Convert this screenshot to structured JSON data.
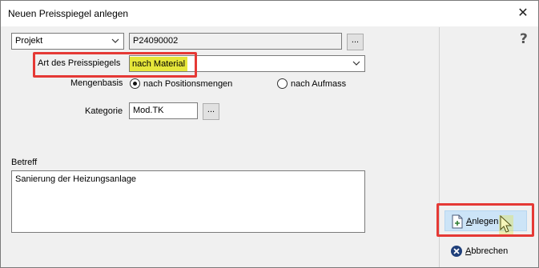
{
  "window": {
    "title": "Neuen Preisspiegel anlegen",
    "close_glyph": "✕"
  },
  "form": {
    "source_type": {
      "value": "Projekt"
    },
    "project_number": {
      "value": "P24090002"
    },
    "browse_project_label": "...",
    "art_label": "Art des Preisspiegels",
    "art_value": "nach Material",
    "mengenbasis_label": "Mengenbasis",
    "mengenbasis_options": [
      {
        "label": "nach Positionsmengen",
        "selected": true
      },
      {
        "label": "nach Aufmass",
        "selected": false
      }
    ],
    "kategorie_label": "Kategorie",
    "kategorie_value": "Mod.TK",
    "browse_kategorie_label": "...",
    "betreff_label": "Betreff",
    "betreff_value": "Sanierung der Heizungsanlage"
  },
  "side": {
    "help_label": "?",
    "anlegen_label": "Anlegen",
    "abbrechen_label": "Abbrechen"
  },
  "colors": {
    "highlight": "#e53935",
    "value_marker": "#e6e63a",
    "button_hover": "#cce4f7"
  }
}
